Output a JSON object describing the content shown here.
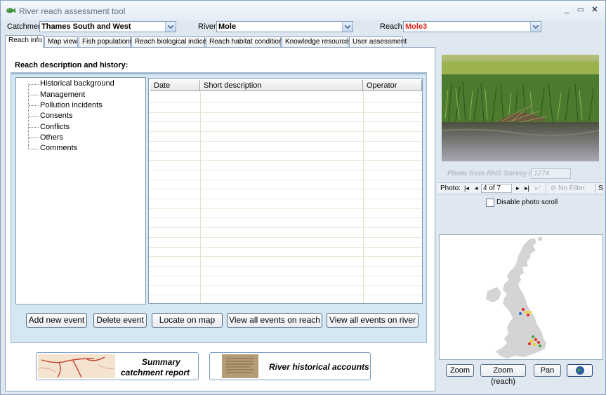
{
  "window": {
    "title": "River reach assessment tool"
  },
  "selectors": {
    "catchment_label": "Catchment:",
    "catchment_value": "Thames South and West",
    "river_label": "River:",
    "river_value": "Mole",
    "reach_label": "Reach:",
    "reach_value": "Mole3",
    "reach_color": "#e0241b"
  },
  "tabs": [
    "Reach info",
    "Map view",
    "Fish populations",
    "Reach biological indices",
    "Reach habitat condition",
    "Knowledge resources",
    "User assessment"
  ],
  "reach_info": {
    "heading": "Reach description and history:",
    "tree": [
      "Historical background",
      "Management",
      "Pollution incidents",
      "Consents",
      "Conflicts",
      "Others",
      "Comments"
    ],
    "columns": [
      "Date",
      "Short description",
      "Operator"
    ],
    "buttons": [
      "Add new event",
      "Delete event",
      "Locate on map",
      "View all events on reach",
      "View all events on river"
    ],
    "summary_label_1": "Summary",
    "summary_label_2": "catchment report",
    "historical_label": "River historical accounts"
  },
  "photo": {
    "source_label": "Photo from RHS Survey id:",
    "survey_id": "1274",
    "nav_label": "Photo:",
    "position": "4 of 7",
    "filter_label": "No Filter",
    "search_stub": "S",
    "disable_scroll_label": "Disable photo scroll"
  },
  "map": {
    "buttons": [
      "Zoom",
      "Zoom (reach)",
      "Pan"
    ]
  }
}
